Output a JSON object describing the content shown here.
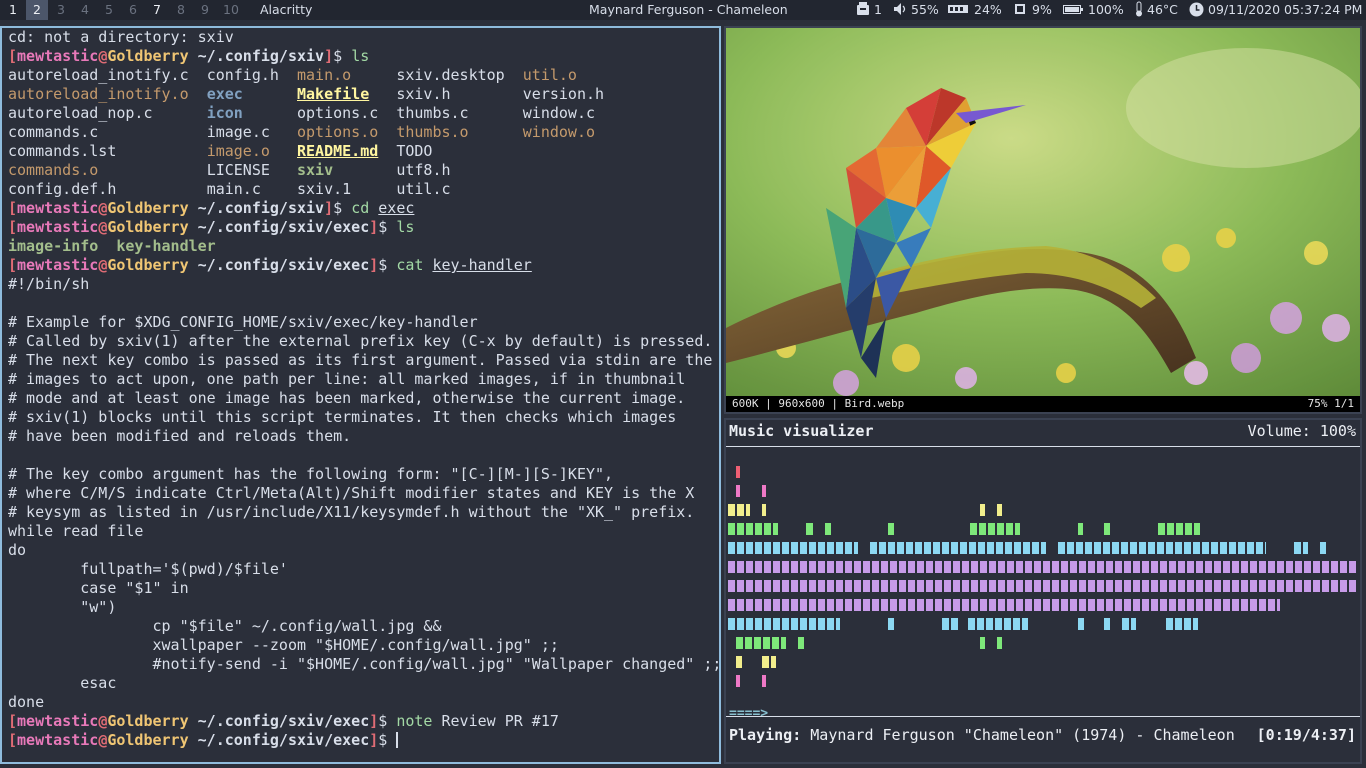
{
  "statusbar": {
    "workspaces": [
      "1",
      "2",
      "3",
      "4",
      "5",
      "6",
      "7",
      "8",
      "9",
      "10"
    ],
    "active_workspace": "2",
    "occupied": [
      "1",
      "2",
      "7"
    ],
    "window_title": "Alacritty",
    "now_playing": "Maynard Ferguson - Chameleon",
    "updates": "1",
    "volume": "55%",
    "memory": "24%",
    "cpu": "9%",
    "battery": "100%",
    "temperature": "46°C",
    "datetime": "09/11/2020 05:37:24 PM"
  },
  "terminal": {
    "prompt": {
      "user": "mewtastic",
      "host": "Goldberry"
    },
    "error_line": "cd: not a directory: sxiv",
    "ls_rows": [
      [
        [
          "autoreload_inotify.c",
          "file"
        ],
        [
          "config.h",
          "file"
        ],
        [
          "main.o",
          "o"
        ],
        [
          "sxiv.desktop",
          "file"
        ],
        [
          "util.o",
          "o"
        ]
      ],
      [
        [
          "autoreload_inotify.o",
          "o"
        ],
        [
          "exec",
          "dir"
        ],
        [
          "Makefile",
          "md"
        ],
        [
          "sxiv.h",
          "file"
        ],
        [
          "version.h",
          "file"
        ]
      ],
      [
        [
          "autoreload_nop.c",
          "file"
        ],
        [
          "icon",
          "dir"
        ],
        [
          "options.c",
          "file"
        ],
        [
          "thumbs.c",
          "file"
        ],
        [
          "window.c",
          "file"
        ]
      ],
      [
        [
          "commands.c",
          "file"
        ],
        [
          "image.c",
          "file"
        ],
        [
          "options.o",
          "o"
        ],
        [
          "thumbs.o",
          "o"
        ],
        [
          "window.o",
          "o"
        ]
      ],
      [
        [
          "commands.lst",
          "file"
        ],
        [
          "image.o",
          "o"
        ],
        [
          "README.md",
          "md"
        ],
        [
          "TODO",
          "file"
        ],
        [
          "",
          ""
        ]
      ],
      [
        [
          "commands.o",
          "o"
        ],
        [
          "LICENSE",
          "file"
        ],
        [
          "sxiv",
          "exe"
        ],
        [
          "utf8.h",
          "file"
        ],
        [
          "",
          ""
        ]
      ],
      [
        [
          "config.def.h",
          "file"
        ],
        [
          "main.c",
          "file"
        ],
        [
          "sxiv.1",
          "file"
        ],
        [
          "util.c",
          "file"
        ],
        [
          "",
          ""
        ]
      ]
    ],
    "cmd_ls": "ls",
    "path_sxiv": "~/.config/sxiv",
    "path_exec": "~/.config/sxiv/exec",
    "cmd_cd": "cd",
    "cmd_cd_arg": "exec",
    "exec_ls": [
      "image-info",
      "key-handler"
    ],
    "cmd_cat": "cat",
    "cmd_cat_arg": "key-handler",
    "script_lines": [
      "#!/bin/sh",
      "",
      "# Example for $XDG_CONFIG_HOME/sxiv/exec/key-handler",
      "# Called by sxiv(1) after the external prefix key (C-x by default) is pressed.",
      "# The next key combo is passed as its first argument. Passed via stdin are the",
      "# images to act upon, one path per line: all marked images, if in thumbnail",
      "# mode and at least one image has been marked, otherwise the current image.",
      "# sxiv(1) blocks until this script terminates. It then checks which images",
      "# have been modified and reloads them.",
      "",
      "# The key combo argument has the following form: \"[C-][M-][S-]KEY\",",
      "# where C/M/S indicate Ctrl/Meta(Alt)/Shift modifier states and KEY is the X",
      "# keysym as listed in /usr/include/X11/keysymdef.h without the \"XK_\" prefix.",
      "while read file",
      "do",
      "        fullpath='$(pwd)/$file'",
      "        case \"$1\" in",
      "        \"w\")",
      "                cp \"$file\" ~/.config/wall.jpg &&",
      "                xwallpaper --zoom \"$HOME/.config/wall.jpg\" ;;",
      "                #notify-send -i \"$HOME/.config/wall.jpg\" \"Wallpaper changed\" ;;",
      "        esac",
      "done"
    ],
    "cmd_note": "note",
    "cmd_note_arg": "Review PR #17"
  },
  "image_viewer": {
    "info_left": "600K | 960x600 | Bird.webp",
    "info_right": "75%  1/1"
  },
  "visualizer": {
    "title": "Music visualizer",
    "volume": "Volume: 100%",
    "progress": "====>",
    "playing_label": "Playing:",
    "playing_track": "Maynard Ferguson \"Chameleon\" (1974) - Chameleon",
    "time": "[0:19/4:37]",
    "colors": {
      "red": "#ee5f73",
      "pink": "#ee79c6",
      "yellow": "#f2ee8c",
      "green": "#7ee87a",
      "cyan": "#8cd8f2",
      "violet": "#c79be8"
    }
  }
}
